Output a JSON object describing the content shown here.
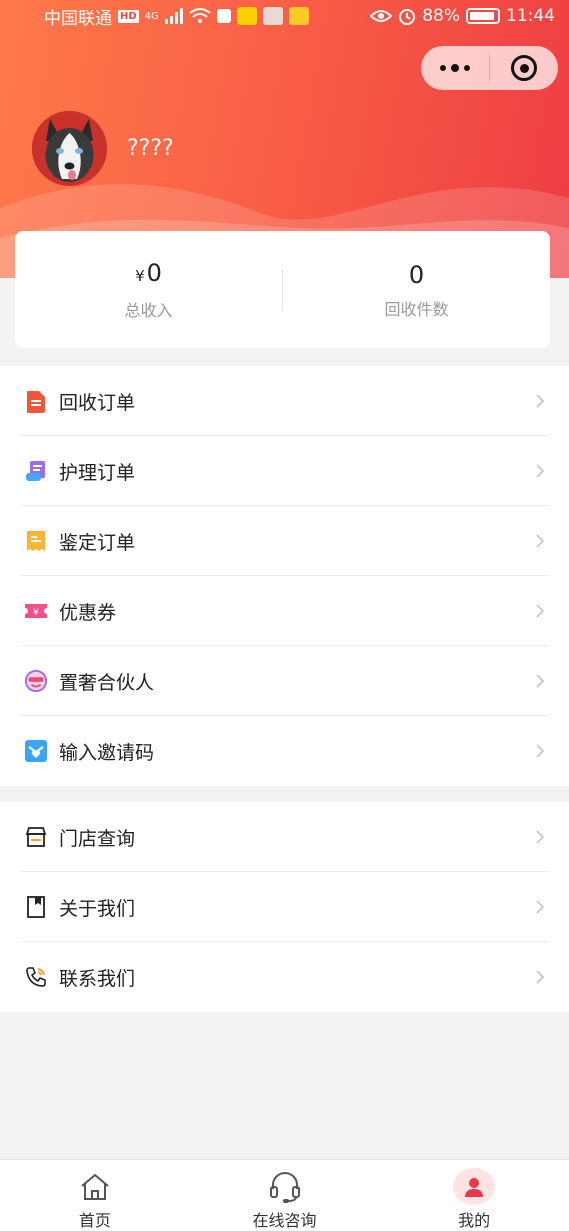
{
  "status_bar": {
    "carrier": "中国联通",
    "hd": "HD",
    "network": "4G",
    "battery": "88%",
    "time": "11:44"
  },
  "user": {
    "name": "????"
  },
  "stats": {
    "currency": "¥",
    "income_value": "0",
    "income_label": "总收入",
    "count_value": "0",
    "count_label": "回收件数"
  },
  "menu_group_1": [
    {
      "label": "回收订单",
      "icon": "recycle-order-icon"
    },
    {
      "label": "护理订单",
      "icon": "care-order-icon"
    },
    {
      "label": "鉴定订单",
      "icon": "appraisal-order-icon"
    },
    {
      "label": "优惠券",
      "icon": "coupon-icon"
    },
    {
      "label": "置奢合伙人",
      "icon": "partner-icon"
    },
    {
      "label": "输入邀请码",
      "icon": "invite-code-icon"
    }
  ],
  "menu_group_2": [
    {
      "label": "门店查询",
      "icon": "store-icon"
    },
    {
      "label": "关于我们",
      "icon": "about-icon"
    },
    {
      "label": "联系我们",
      "icon": "phone-icon"
    }
  ],
  "tabbar": [
    {
      "label": "首页",
      "icon": "home-icon"
    },
    {
      "label": "在线咨询",
      "icon": "headset-icon"
    },
    {
      "label": "我的",
      "icon": "user-icon",
      "active": true
    }
  ],
  "colors": {
    "brand_start": "#ff7a4a",
    "brand_end": "#ee3d43",
    "background": "#f3f3f3"
  }
}
